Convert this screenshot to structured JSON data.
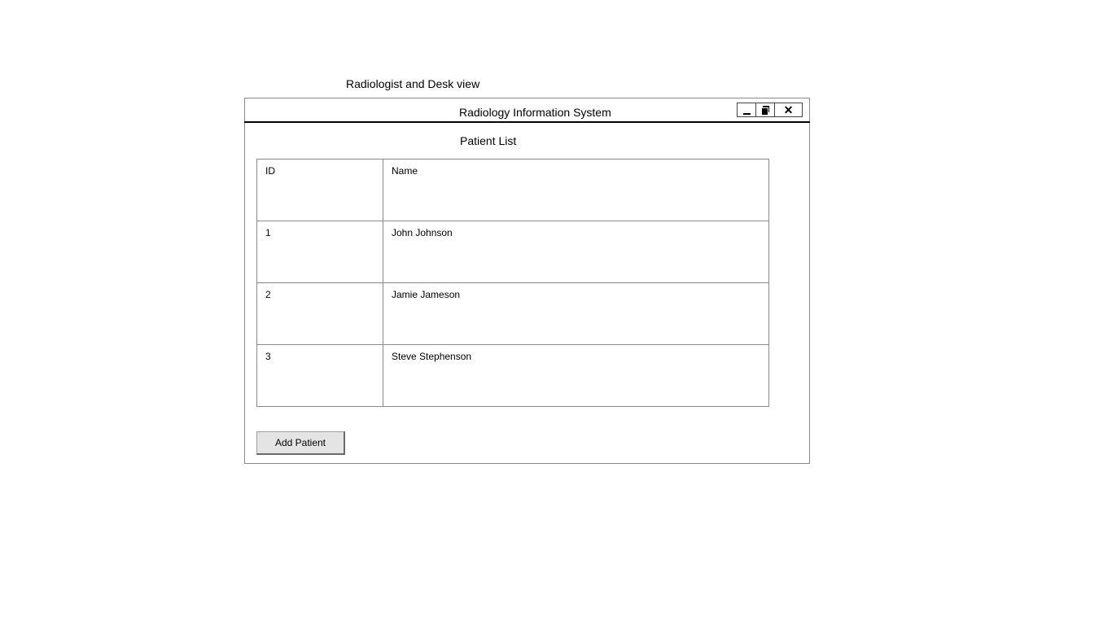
{
  "page": {
    "caption": "Radiologist and Desk view"
  },
  "window": {
    "title": "Radiology Information System",
    "controls": {
      "minimize_icon": "minimize-icon",
      "restore_icon": "restore-icon",
      "close_icon": "close-icon"
    }
  },
  "patient_list": {
    "title": "Patient List",
    "columns": [
      "ID",
      "Name"
    ],
    "rows": [
      {
        "id": "1",
        "name": "John Johnson"
      },
      {
        "id": "2",
        "name": "Jamie Jameson"
      },
      {
        "id": "3",
        "name": "Steve Stephenson"
      }
    ]
  },
  "actions": {
    "add_patient_label": "Add Patient"
  }
}
